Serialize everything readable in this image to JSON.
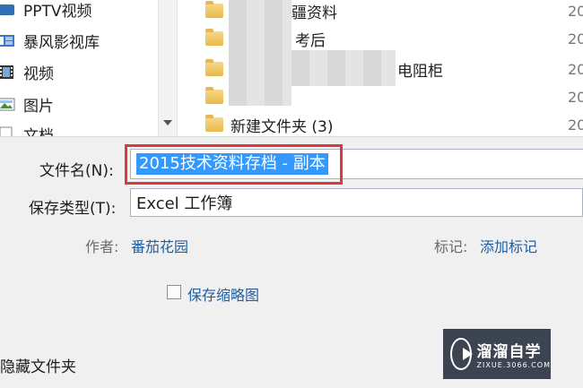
{
  "nav": {
    "items": [
      {
        "label": "PPTV视频",
        "icon": "video-app-icon"
      },
      {
        "label": "暴风影视库",
        "icon": "library-icon"
      },
      {
        "label": "视频",
        "icon": "film-icon"
      },
      {
        "label": "图片",
        "icon": "picture-icon"
      },
      {
        "label": "文档",
        "icon": "document-icon"
      }
    ]
  },
  "files": {
    "items": [
      {
        "name": "疆资料",
        "date": "20"
      },
      {
        "name": "考后",
        "date": "20"
      },
      {
        "name": "电阻柜",
        "date": "20"
      },
      {
        "name": "",
        "date": "20"
      },
      {
        "name": "新建文件夹 (3)",
        "date": "20"
      }
    ]
  },
  "form": {
    "filename_label": "文件名(N):",
    "filename_value": "2015技术资料存档 - 副本",
    "savetype_label": "保存类型(T):",
    "savetype_value": "Excel 工作簿",
    "author_label": "作者:",
    "author_value": "番茄花园",
    "tags_label": "标记:",
    "tags_value": "添加标记",
    "thumbnail_label": "保存缩略图",
    "hide_folders": "隐藏文件夹"
  },
  "watermark": {
    "title": "溜溜自学",
    "url": "ZIXUE.3066.COM"
  },
  "colors": {
    "selection": "#3399ff",
    "highlight": "#d93b3b",
    "link": "#1f5fa0"
  }
}
